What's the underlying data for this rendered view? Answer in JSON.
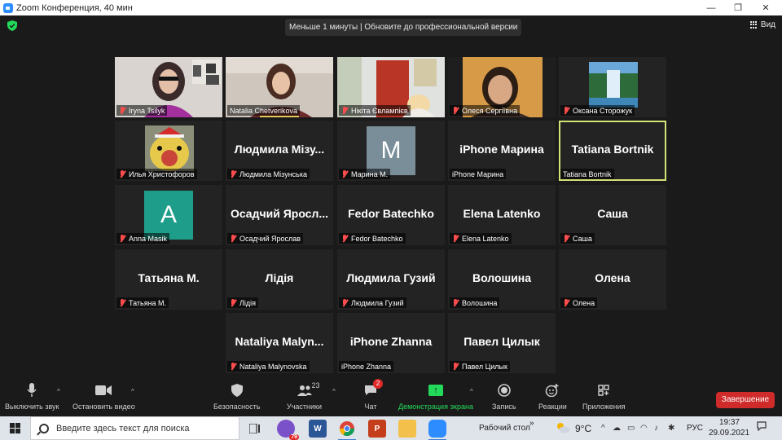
{
  "window": {
    "title": "Zoom Конференция, 40 мин",
    "controls": {
      "minimize": "—",
      "maximize": "❐",
      "close": "✕"
    }
  },
  "topbar": {
    "notice": "Меньше 1 минуты | Обновите до профессиональной версии",
    "view_label": "Вид"
  },
  "participants": [
    {
      "label": "Iryna Tsilyk",
      "display": "",
      "video": true,
      "muted": true
    },
    {
      "label": "Natalia Chetverikova",
      "display": "",
      "video": true,
      "muted": false,
      "speaking": true
    },
    {
      "label": "Нікіта Євлампієв",
      "display": "",
      "video": true,
      "muted": true
    },
    {
      "label": "Олеся Сергіївна",
      "display": "",
      "video": true,
      "muted": true
    },
    {
      "label": "Оксана Сторожук",
      "display": "",
      "video": false,
      "avatar": "waterfall",
      "muted": true
    },
    {
      "label": "Илья Христофоров",
      "display": "",
      "video": false,
      "avatar": "bird",
      "muted": true
    },
    {
      "label": "Людмила Мізунська",
      "display": "Людмила  Мізу...",
      "video": false,
      "muted": true
    },
    {
      "label": "Марина М.",
      "display": "",
      "video": false,
      "avatar_letter": "M",
      "avatar_color": "#7a8e9a",
      "muted": true
    },
    {
      "label": "iPhone Марина",
      "display": "iPhone Марина",
      "video": false,
      "muted": false
    },
    {
      "label": "Tatiana Bortnik",
      "display": "Tatiana Bortnik",
      "video": false,
      "muted": false,
      "active": true
    },
    {
      "label": "Anna Masik",
      "display": "",
      "video": false,
      "avatar_letter": "A",
      "avatar_color": "#1e9e8a",
      "muted": true
    },
    {
      "label": "Осадчий Ярослав",
      "display": "Осадчий  Яросл...",
      "video": false,
      "muted": true
    },
    {
      "label": "Fedor Batechko",
      "display": "Fedor Batechko",
      "video": false,
      "muted": true
    },
    {
      "label": "Elena Latenko",
      "display": "Elena Latenko",
      "video": false,
      "muted": true
    },
    {
      "label": "Саша",
      "display": "Саша",
      "video": false,
      "muted": true
    },
    {
      "label": "Татьяна М.",
      "display": "Татьяна М.",
      "video": false,
      "muted": true
    },
    {
      "label": "Лідія",
      "display": "Лідія",
      "video": false,
      "muted": true
    },
    {
      "label": "Людмила Гузий",
      "display": "Людмила Гузий",
      "video": false,
      "muted": true
    },
    {
      "label": "Волошина",
      "display": "Волошина",
      "video": false,
      "muted": true
    },
    {
      "label": "Олена",
      "display": "Олена",
      "video": false,
      "muted": true
    },
    {
      "label": "Nataliya Malynovska",
      "display": "Nataliya  Malyn...",
      "video": false,
      "muted": true
    },
    {
      "label": "iPhone Zhanna",
      "display": "iPhone Zhanna",
      "video": false,
      "muted": false
    },
    {
      "label": "Павел Цилык",
      "display": "Павел Цилык",
      "video": false,
      "muted": true
    }
  ],
  "toolbar": {
    "mute": "Выключить звук",
    "stop_video": "Остановить видео",
    "security": "Безопасность",
    "participants": "Участники",
    "participants_count": "23",
    "chat": "Чат",
    "chat_badge": "2",
    "share": "Демонстрация экрана",
    "record": "Запись",
    "reactions": "Реакции",
    "apps": "Приложения",
    "end": "Завершение",
    "share_color": "#23d959",
    "end_color": "#d02b2b"
  },
  "taskbar": {
    "search_placeholder": "Введите здесь текст для поиска",
    "desktop": "Рабочий стол",
    "desktop_arrow": "»",
    "weather": "9°C",
    "lang": "РУС",
    "time": "19:37",
    "date": "29.09.2021",
    "viber_badge": "79",
    "word_letter": "W",
    "ppt_letter": "P"
  }
}
